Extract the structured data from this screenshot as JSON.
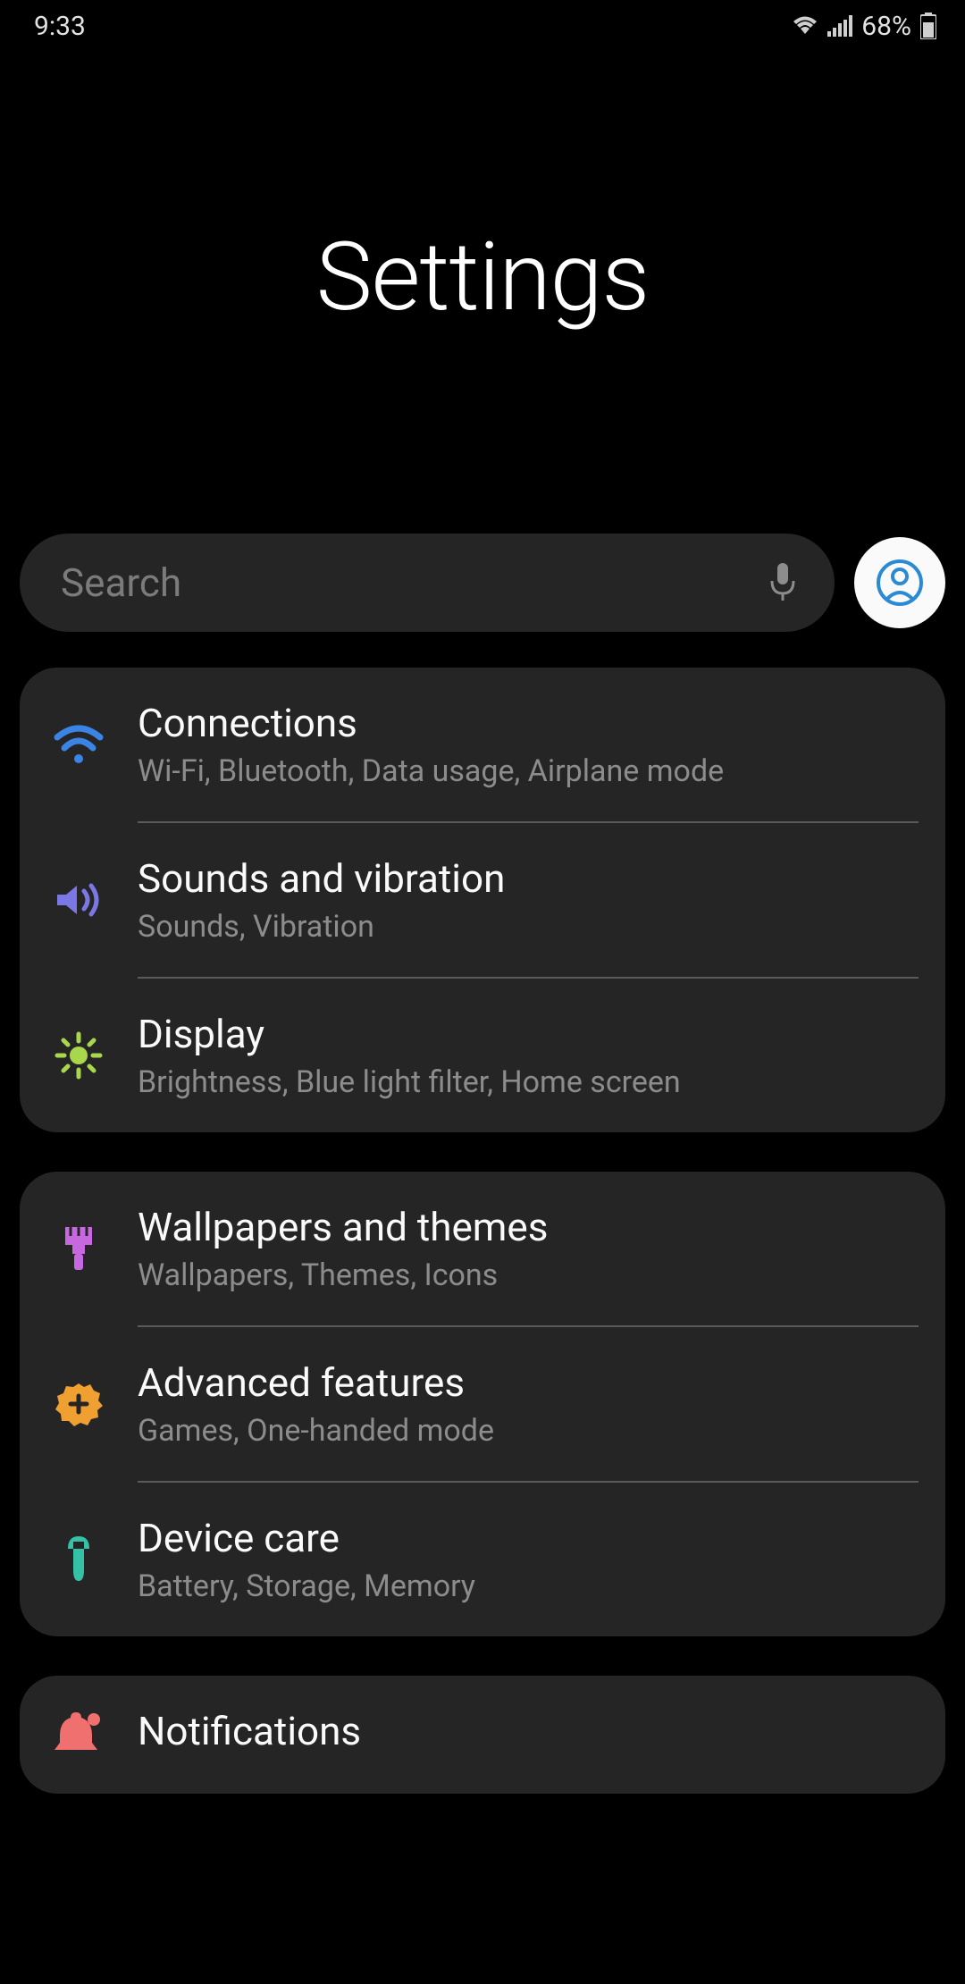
{
  "status": {
    "time": "9:33",
    "battery": "68%"
  },
  "title": "Settings",
  "search": {
    "placeholder": "Search"
  },
  "groups": [
    {
      "items": [
        {
          "icon": "wifi",
          "title": "Connections",
          "sub": "Wi-Fi, Bluetooth, Data usage, Airplane mode"
        },
        {
          "icon": "sound",
          "title": "Sounds and vibration",
          "sub": "Sounds, Vibration"
        },
        {
          "icon": "display",
          "title": "Display",
          "sub": "Brightness, Blue light filter, Home screen"
        }
      ]
    },
    {
      "items": [
        {
          "icon": "brush",
          "title": "Wallpapers and themes",
          "sub": "Wallpapers, Themes, Icons"
        },
        {
          "icon": "gear",
          "title": "Advanced features",
          "sub": "Games, One-handed mode"
        },
        {
          "icon": "wrench",
          "title": "Device care",
          "sub": "Battery, Storage, Memory"
        }
      ]
    },
    {
      "items": [
        {
          "icon": "bell",
          "title": "Notifications",
          "sub": ""
        }
      ]
    }
  ]
}
